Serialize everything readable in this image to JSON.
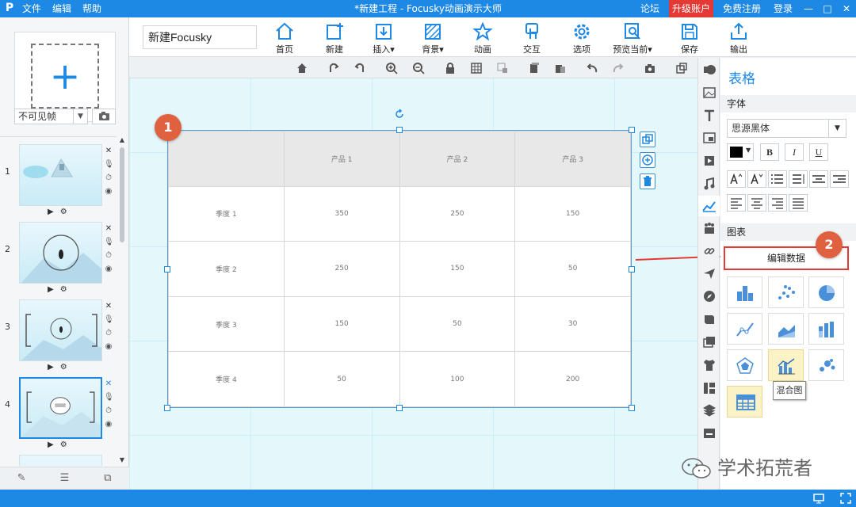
{
  "titlebar": {
    "logo": "P",
    "menu": [
      "文件",
      "编辑",
      "帮助"
    ],
    "window_title": "*新建工程 - Focusky动画演示大师",
    "forum": "论坛",
    "upgrade": "升级账户",
    "register": "免费注册",
    "login": "登录",
    "minimize": "—",
    "maximize": "□",
    "close": "✕"
  },
  "toolbar": {
    "project_name": "新建Focusky",
    "buttons": [
      {
        "label": "首页",
        "icon": "home-icon"
      },
      {
        "label": "新建",
        "icon": "new-frame-icon"
      },
      {
        "label": "插入▾",
        "icon": "insert-icon"
      },
      {
        "label": "背景▾",
        "icon": "background-icon"
      },
      {
        "label": "动画",
        "icon": "star-animation-icon"
      },
      {
        "label": "交互",
        "icon": "interaction-hand-icon"
      },
      {
        "label": "选项",
        "icon": "gear-icon"
      },
      {
        "label": "预览当前▾",
        "icon": "preview-icon"
      },
      {
        "label": "保存",
        "icon": "save-icon"
      },
      {
        "label": "输出",
        "icon": "export-icon"
      }
    ]
  },
  "left_panel": {
    "add_frame": "+",
    "frame_mode": "不可见帧",
    "thumbnails": [
      {
        "number": "1",
        "active": false
      },
      {
        "number": "2",
        "active": false
      },
      {
        "number": "3",
        "active": false
      },
      {
        "number": "4",
        "active": true
      }
    ]
  },
  "table": {
    "header": [
      "",
      "产品 1",
      "产品 2",
      "产品 3"
    ],
    "rows": [
      [
        "季度 1",
        "350",
        "250",
        "150"
      ],
      [
        "季度 2",
        "250",
        "150",
        "50"
      ],
      [
        "季度 3",
        "150",
        "50",
        "30"
      ],
      [
        "季度 4",
        "50",
        "100",
        "200"
      ]
    ]
  },
  "annotations": {
    "badge1": "1",
    "badge2": "2"
  },
  "right_panel": {
    "title": "表格",
    "font_section": "字体",
    "font_name": "思源黑体",
    "bold": "B",
    "italic": "I",
    "underline": "U",
    "chart_section": "图表",
    "edit_data": "编辑数据",
    "chart_types": [
      {
        "name": "bar-chart-icon"
      },
      {
        "name": "scatter-chart-icon"
      },
      {
        "name": "pie-chart-icon"
      },
      {
        "name": "line-chart-icon"
      },
      {
        "name": "area-chart-icon"
      },
      {
        "name": "column-chart-icon"
      },
      {
        "name": "radar-chart-icon"
      },
      {
        "name": "mixed-chart-icon"
      },
      {
        "name": "bubble-chart-icon"
      },
      {
        "name": "table-icon"
      }
    ],
    "tooltip": "混合图",
    "watermark": "学术拓荒者"
  },
  "colors": {
    "brand_blue": "#1e88e5",
    "badge": "#e0613f",
    "highlight_red": "#e53935",
    "selected_chart_bg": "#fbf2c6"
  }
}
